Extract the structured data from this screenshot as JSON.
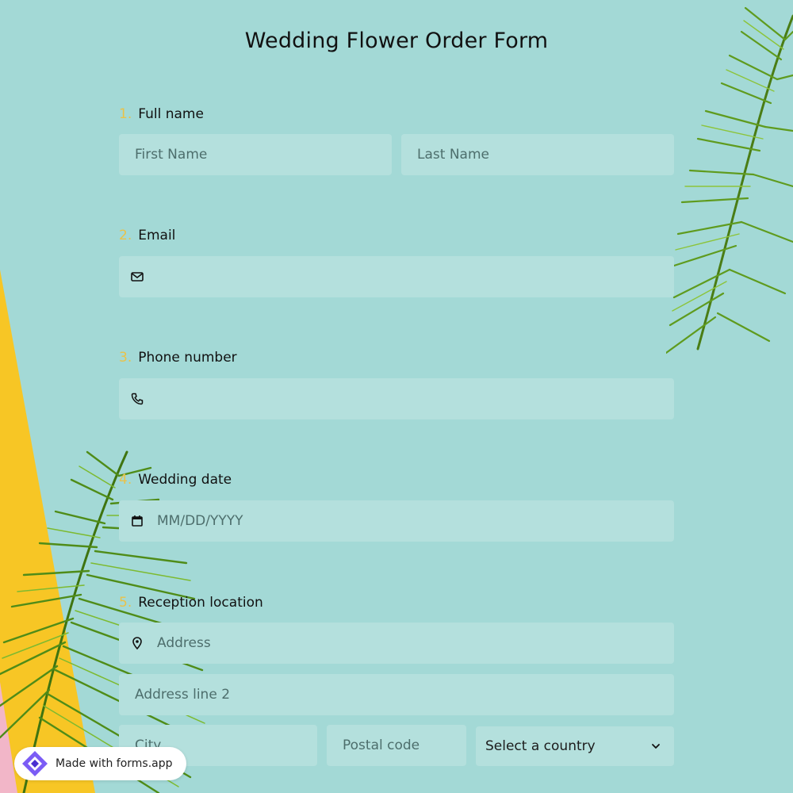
{
  "form": {
    "title": "Wedding Flower Order Form",
    "questions": [
      {
        "number": "1.",
        "label": "Full name"
      },
      {
        "number": "2.",
        "label": "Email"
      },
      {
        "number": "3.",
        "label": "Phone number"
      },
      {
        "number": "4.",
        "label": "Wedding date"
      },
      {
        "number": "5.",
        "label": "Reception location"
      }
    ],
    "fields": {
      "first_name_placeholder": "First Name",
      "last_name_placeholder": "Last Name",
      "email_placeholder": "",
      "phone_placeholder": "",
      "date_placeholder": "MM/DD/YYYY",
      "address_placeholder": "Address",
      "address2_placeholder": "Address line 2",
      "city_placeholder": "City",
      "postal_placeholder": "Postal code",
      "country_selected": "Select a country"
    },
    "icons": {
      "email": "envelope-icon",
      "phone": "phone-icon",
      "date": "calendar-icon",
      "address": "map-pin-icon",
      "select": "chevron-down-icon"
    }
  },
  "badge": {
    "label": "Made with forms.app"
  },
  "colors": {
    "background": "#a3d9d6",
    "field": "#b4e0dd",
    "accent_number": "#e9c24a",
    "yellow_strip": "#f7c625",
    "palm_green": "#6aa820"
  }
}
